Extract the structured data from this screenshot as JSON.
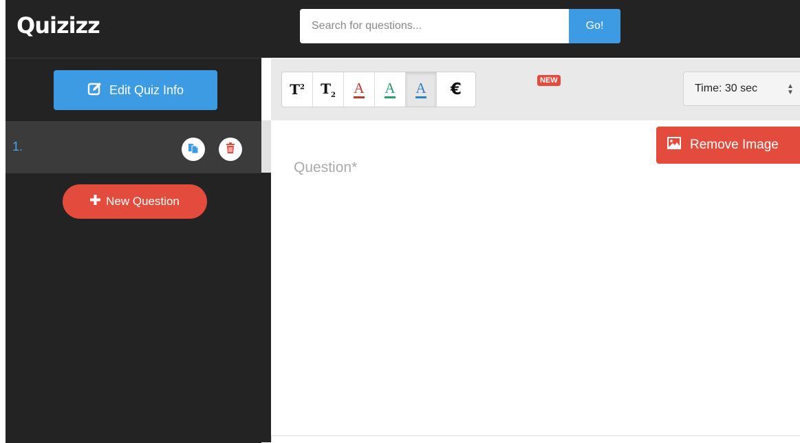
{
  "header": {
    "logo_text": "Quizizz",
    "search": {
      "placeholder": "Search for questions...",
      "value": "",
      "button_label": "Go!"
    }
  },
  "sidebar": {
    "edit_quiz_label": "Edit Quiz Info",
    "questions": [
      {
        "number": "1."
      }
    ],
    "new_question_label": "New Question"
  },
  "toolbar": {
    "buttons": [
      {
        "name": "superscript",
        "label": "T",
        "marker": "2"
      },
      {
        "name": "subscript",
        "label": "T",
        "marker": "2"
      },
      {
        "name": "color-red",
        "label": "A",
        "color": "#c0392b"
      },
      {
        "name": "color-green",
        "label": "A",
        "color": "#27a06a"
      },
      {
        "name": "color-blue",
        "label": "A",
        "color": "#2f80c8",
        "active": true
      },
      {
        "name": "math",
        "label": "€"
      }
    ],
    "new_badge": "NEW",
    "time_select": {
      "value": "Time: 30 sec",
      "options": [
        "Time: 30 sec"
      ]
    }
  },
  "editor": {
    "question_placeholder": "Question*",
    "remove_image_label": "Remove Image"
  },
  "colors": {
    "dark_bg": "#232323",
    "row_active": "#3b3b3b",
    "accent_blue": "#3d9be3",
    "accent_red": "#e34b3c",
    "number_blue": "#4aa3e8"
  },
  "icons": [
    "edit-icon",
    "copy-icon",
    "trash-icon",
    "plus-icon",
    "image-icon",
    "sort-arrows-icon"
  ]
}
